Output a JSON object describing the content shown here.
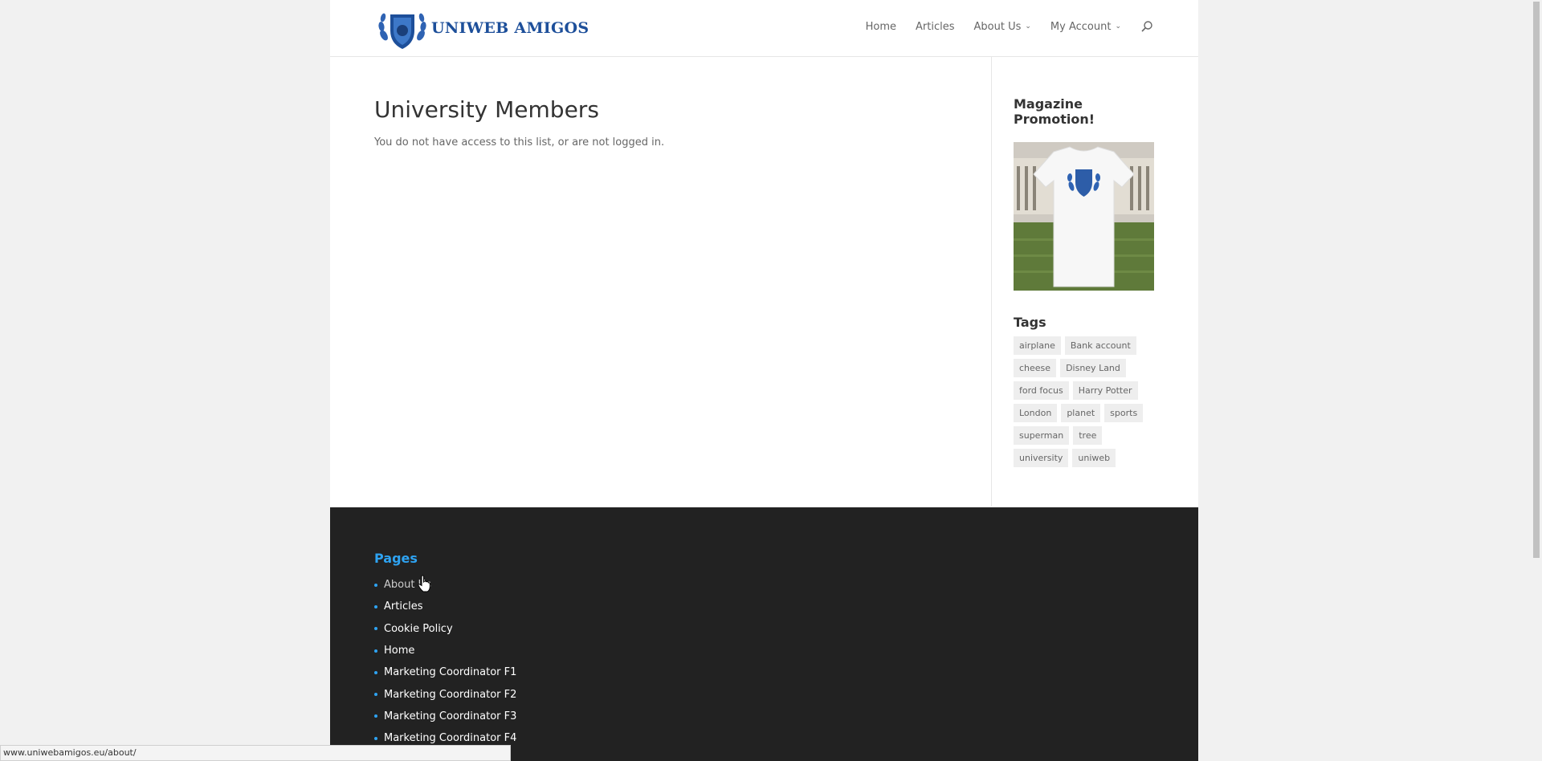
{
  "header": {
    "logo_text": "UNIWEB AMIGOS",
    "nav": [
      {
        "label": "Home",
        "dropdown": false
      },
      {
        "label": "Articles",
        "dropdown": false
      },
      {
        "label": "About Us",
        "dropdown": true
      },
      {
        "label": "My Account",
        "dropdown": true
      }
    ]
  },
  "main": {
    "title": "University Members",
    "notice": "You do not have access to this list, or are not logged in."
  },
  "sidebar": {
    "promo_title": "Magazine Promotion!",
    "tags_title": "Tags",
    "tags": [
      "airplane",
      "Bank account",
      "cheese",
      "Disney Land",
      "ford focus",
      "Harry Potter",
      "London",
      "planet",
      "sports",
      "superman",
      "tree",
      "university",
      "uniweb"
    ]
  },
  "footer": {
    "title": "Pages",
    "pages": [
      "About Us",
      "Articles",
      "Cookie Policy",
      "Home",
      "Marketing Coordinator F1",
      "Marketing Coordinator F2",
      "Marketing Coordinator F3",
      "Marketing Coordinator F4"
    ]
  },
  "status_url": "www.uniwebamigos.eu/about/",
  "colors": {
    "accent": "#2ea3f2",
    "footer_bg": "#222222",
    "logo_blue": "#1d4f9a"
  }
}
